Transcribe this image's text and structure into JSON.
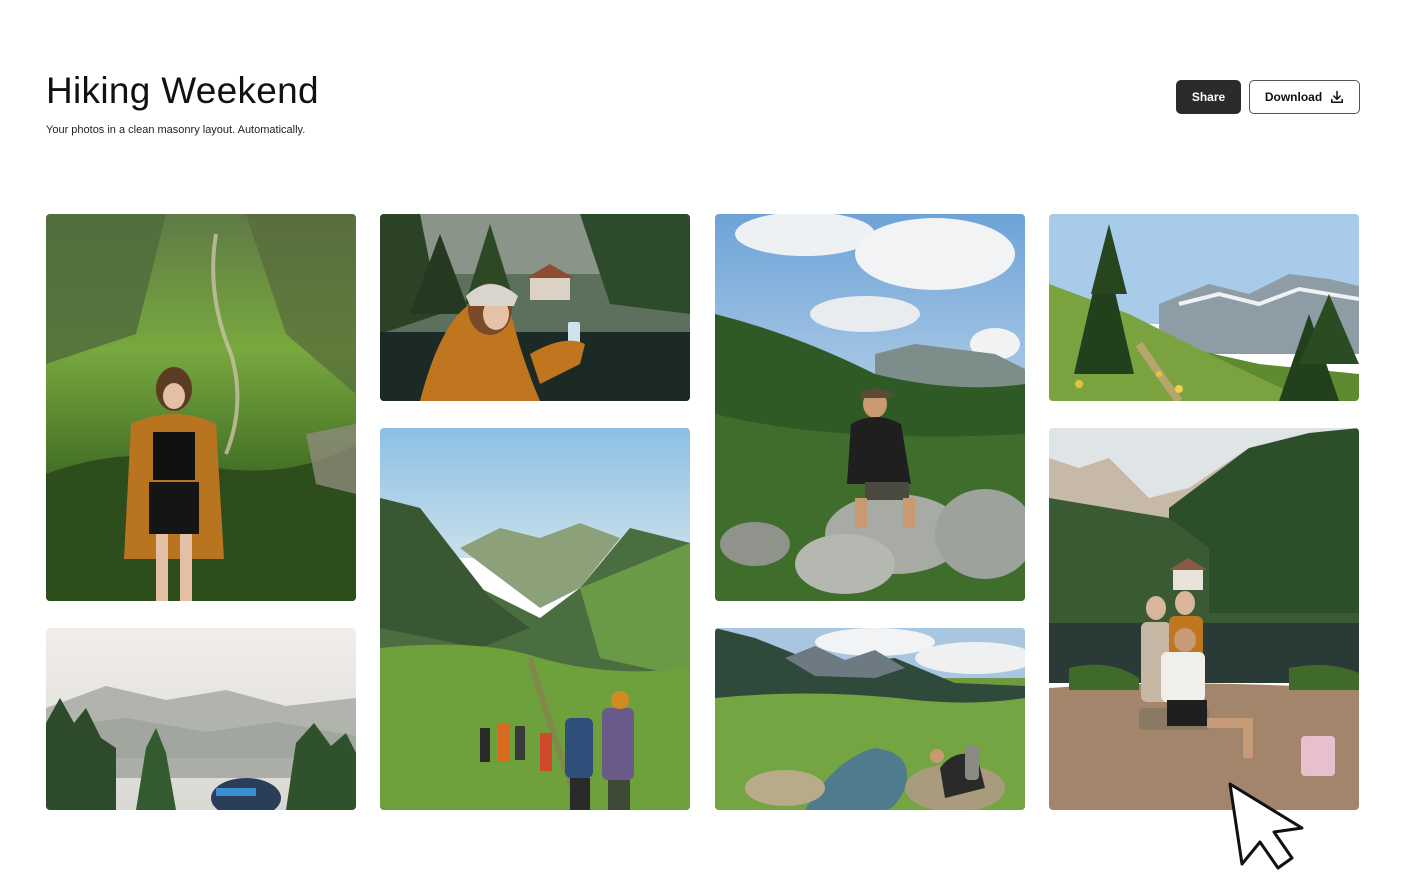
{
  "header": {
    "title": "Hiking Weekend",
    "subtitle": "Your photos in a clean masonry layout. Automatically."
  },
  "toolbar": {
    "share_label": "Share",
    "download_label": "Download",
    "download_icon": "download-icon"
  },
  "gallery": {
    "photos": [
      "woman-portrait-green-mountain-slope",
      "woman-with-bandana-holding-can-by-lake",
      "man-sitting-on-boulder-under-clouds",
      "pine-trees-on-sunny-trail",
      "misty-mountains-and-pine-tops",
      "hikers-walking-down-green-valley",
      "hiker-kneeling-at-mountain-stream",
      "group-of-friends-by-lake-with-cabin"
    ]
  },
  "colors": {
    "share_background": "#2b2b2b",
    "download_border": "#555555",
    "page_background": "#ffffff"
  }
}
